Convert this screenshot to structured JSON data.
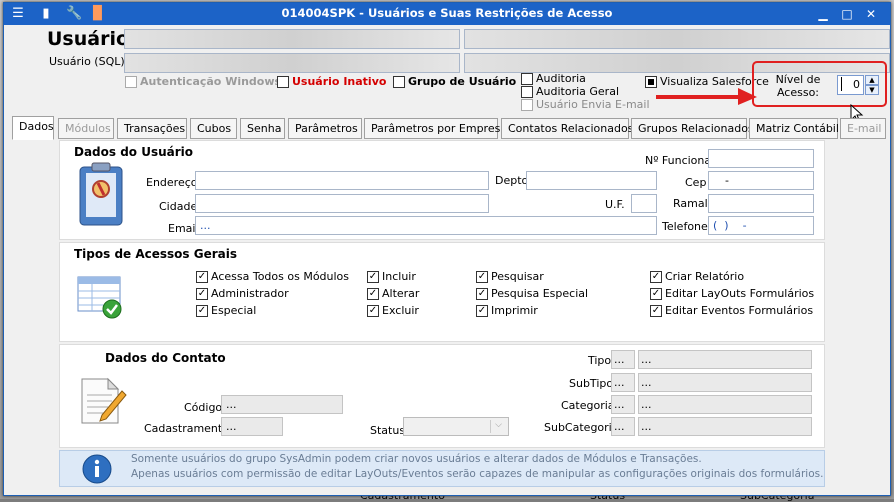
{
  "window": {
    "title": "014004SPK - Usuários e Suas Restrições de Acesso"
  },
  "header": {
    "usuario_label": "Usuário",
    "usuario_sql_label": "Usuário (SQL):",
    "checks": [
      {
        "label": "Autenticação Windows",
        "checked": false,
        "disabled": true
      },
      {
        "label": "Usuário Inativo",
        "checked": false,
        "disabled": false
      },
      {
        "label": "Grupo de Usuário",
        "checked": false,
        "disabled": false
      }
    ],
    "audit": [
      {
        "label": "Auditoria",
        "checked": false
      },
      {
        "label": "Auditoria Geral",
        "checked": false
      },
      {
        "label": "Usuário Envia E-mail",
        "checked": false
      }
    ],
    "visualiza_salesforce": "Visualiza Salesforce",
    "nivel_label": "Nível de Acesso:",
    "nivel_value": "0"
  },
  "tabs": [
    "Dados",
    "Módulos",
    "Transações",
    "Cubos",
    "Senha",
    "Parâmetros",
    "Parâmetros por Empresa",
    "Contatos Relacionados",
    "Grupos Relacionados",
    "Matriz Contábil",
    "E-mail"
  ],
  "dados_usuario": {
    "title": "Dados do Usuário",
    "funcional_label": "Nº Funcional",
    "endereco_label": "Endereço",
    "depto_label": "Depto",
    "cep_label": "Cep",
    "cep_value": "-",
    "cidade_label": "Cidade",
    "uf_label": "U.F.",
    "ramal_label": "Ramal",
    "email_label": "Email",
    "email_value": "...",
    "telefone_label": "Telefone",
    "telefone_value": "(  )    -"
  },
  "tipos_acessos": {
    "title": "Tipos de Acessos Gerais",
    "col1": [
      "Acessa Todos os Módulos",
      "Administrador",
      "Especial"
    ],
    "col2": [
      "Incluir",
      "Alterar",
      "Excluir"
    ],
    "col3": [
      "Pesquisar",
      "Pesquisa Especial",
      "Imprimir"
    ],
    "col4": [
      "Criar Relatório",
      "Editar LayOuts Formulários",
      "Editar Eventos Formulários"
    ]
  },
  "dados_contato": {
    "title": "Dados do Contato",
    "codigo_label": "Código",
    "codigo_value": "...",
    "cadastramento_label": "Cadastramento",
    "cadastramento_value": "...",
    "status_label": "Status",
    "tipo_label": "Tipo",
    "subtipo_label": "SubTipo",
    "categoria_label": "Categoria",
    "subcategoria_label": "SubCategoria",
    "dots": "..."
  },
  "info": {
    "line1": "Somente usuários do grupo SysAdmin podem criar novos usuários e alterar dados de Módulos e Transações.",
    "line2": "Apenas usuários com permissão de editar LayOuts/Eventos serão capazes de manipular as configurações originais dos formulários."
  },
  "bg_strip": {
    "cadastramento": "Cadastramento",
    "status": "Status",
    "subcategoria": "SubCategoria"
  },
  "colors": {
    "titlebar": "#1c63c7",
    "inactive_red": "#d40000",
    "highlight_red": "#e02020"
  }
}
